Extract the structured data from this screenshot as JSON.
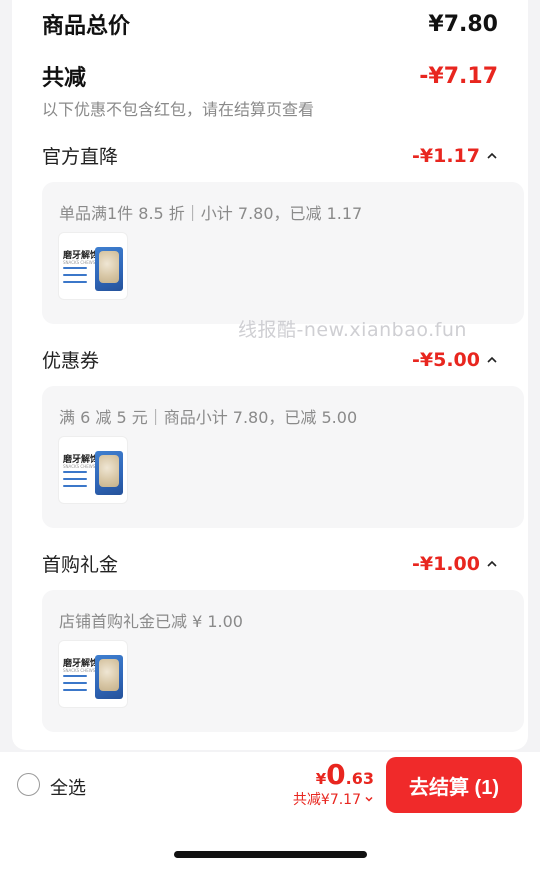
{
  "summary": {
    "total_label": "商品总价",
    "total_value": "¥7.80",
    "discount_label": "共减",
    "discount_value": "-¥7.17",
    "note": "以下优惠不包含红包，请在结算页查看"
  },
  "sections": [
    {
      "title": "官方直降",
      "amount": "-¥1.17",
      "detail": "单品满1件 8.5 折｜小计 7.80，已减 1.17",
      "product_title": "磨牙解馋",
      "product_subtitle": "SNACKS CHEWS"
    },
    {
      "title": "优惠券",
      "amount": "-¥5.00",
      "detail": "满 6 减 5 元｜商品小计 7.80，已减 5.00",
      "product_title": "磨牙解馋",
      "product_subtitle": "SNACKS CHEWS"
    },
    {
      "title": "首购礼金",
      "amount": "-¥1.00",
      "detail": "店铺首购礼金已减 ¥ 1.00",
      "product_title": "磨牙解馋",
      "product_subtitle": "SNACKS CHEWS"
    }
  ],
  "watermark": "线报酷-new.xianbao.fun",
  "bottom_bar": {
    "select_all": "全选",
    "currency": "¥",
    "total_integer": "0",
    "total_decimal": ".63",
    "total_discount": "共减¥7.17",
    "checkout": "去结算 (1)"
  },
  "colors": {
    "accent": "#e8261f",
    "checkout_button": "#f02a2a"
  },
  "icons": {
    "section_toggle": "chevron-up-icon",
    "discount_toggle": "chevron-down-icon",
    "select_all": "radio-circle-icon"
  }
}
